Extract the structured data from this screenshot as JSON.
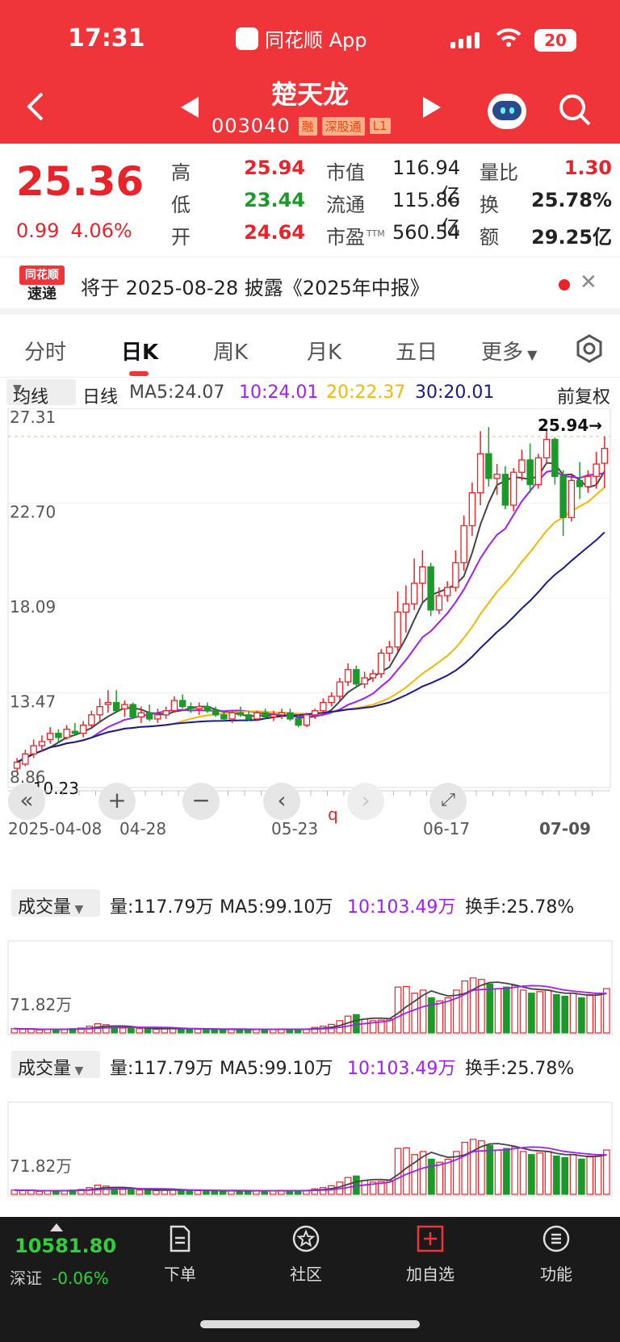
{
  "status": {
    "time": "17:31",
    "app": "同花顺 App",
    "battery": "20"
  },
  "header": {
    "title": "楚天龙",
    "code": "003040",
    "tags": [
      "融",
      "深股通",
      "L1"
    ]
  },
  "quote": {
    "price": "25.36",
    "change": "0.99",
    "pct": "4.06%",
    "high_label": "高",
    "high": "25.94",
    "low_label": "低",
    "low": "23.44",
    "open_label": "开",
    "open": "24.64",
    "mcap_label": "市值",
    "mcap": "116.94亿",
    "float_label": "流通",
    "float": "115.86亿",
    "pe_label": "市盈",
    "pe_sup": "TTM",
    "pe": "560.54",
    "vr_label": "量比",
    "vr": "1.30",
    "turn_label": "换",
    "turn": "25.78%",
    "amt_label": "额",
    "amt": "29.25亿"
  },
  "news": {
    "badge_top": "同花顺",
    "badge_bottom": "速递",
    "text": "将于 2025-08-28 披露《2025年中报》"
  },
  "tabs": [
    "分时",
    "日K",
    "周K",
    "月K",
    "五日",
    "更多"
  ],
  "ma": {
    "dropdown": "均线",
    "kind": "日线",
    "ma5": "MA5:24.07",
    "ma10": "10:24.01",
    "ma20": "20:22.37",
    "ma30": "30:20.01",
    "adjust": "前复权"
  },
  "kline": {
    "y_labels": [
      "27.31",
      "22.70",
      "18.09",
      "13.47",
      "8.86"
    ],
    "high_mark": "25.94→",
    "low_mark": "←10.23",
    "x_labels": [
      "2025-04-08",
      "04-28",
      "05-23",
      "06-17",
      "07-09"
    ],
    "q_mark": "q"
  },
  "volume": {
    "dropdown": "成交量",
    "vol": "量:117.79万",
    "ma5": "MA5:99.10万",
    "ma10": "10:103.49万",
    "turn": "换手:25.78%",
    "y_label": "71.82万"
  },
  "footer": {
    "index": "10581.80",
    "index_name": "深证",
    "index_chg": "-0.06%",
    "nav": [
      "下单",
      "社区",
      "加自选",
      "功能"
    ]
  },
  "colors": {
    "header": "#f0353a",
    "up": "#e8232a",
    "down": "#1b9a2a",
    "ma5": "#444444",
    "ma10": "#a020f0",
    "ma20": "#f5b800",
    "ma30": "#1a1a90"
  },
  "chart_data": {
    "type": "candlestick",
    "ylim": [
      8.86,
      27.31
    ],
    "candles": [
      [
        9.8,
        10.3,
        9.6,
        10.1
      ],
      [
        10.0,
        10.7,
        9.9,
        10.5
      ],
      [
        10.5,
        11.2,
        10.3,
        10.9
      ],
      [
        10.9,
        11.4,
        10.6,
        11.1
      ],
      [
        11.2,
        11.8,
        11.0,
        11.5
      ],
      [
        11.5,
        11.7,
        11.1,
        11.3
      ],
      [
        11.3,
        11.9,
        11.2,
        11.7
      ],
      [
        11.6,
        12.0,
        11.4,
        11.5
      ],
      [
        11.5,
        12.1,
        11.3,
        11.9
      ],
      [
        11.9,
        12.6,
        11.8,
        12.4
      ],
      [
        12.4,
        13.2,
        12.0,
        12.8
      ],
      [
        12.9,
        13.6,
        12.5,
        13.0
      ],
      [
        13.0,
        13.6,
        12.7,
        12.6
      ],
      [
        12.7,
        13.1,
        12.3,
        12.9
      ],
      [
        12.9,
        13.0,
        12.2,
        12.3
      ],
      [
        12.3,
        12.8,
        12.0,
        12.5
      ],
      [
        12.5,
        12.9,
        12.1,
        12.2
      ],
      [
        12.2,
        12.7,
        12.0,
        12.4
      ],
      [
        12.4,
        12.8,
        12.2,
        12.6
      ],
      [
        12.6,
        13.3,
        12.5,
        13.1
      ],
      [
        13.1,
        13.4,
        12.7,
        12.8
      ],
      [
        12.8,
        13.0,
        12.5,
        12.7
      ],
      [
        12.7,
        13.0,
        12.4,
        12.8
      ],
      [
        12.8,
        13.0,
        12.5,
        12.6
      ],
      [
        12.6,
        12.8,
        12.3,
        12.4
      ],
      [
        12.4,
        12.6,
        12.1,
        12.2
      ],
      [
        12.2,
        12.6,
        12.0,
        12.5
      ],
      [
        12.5,
        12.8,
        12.3,
        12.4
      ],
      [
        12.4,
        12.6,
        12.1,
        12.2
      ],
      [
        12.2,
        12.6,
        12.1,
        12.5
      ],
      [
        12.5,
        12.7,
        12.2,
        12.3
      ],
      [
        12.3,
        12.6,
        12.1,
        12.4
      ],
      [
        12.4,
        12.7,
        12.2,
        12.5
      ],
      [
        12.5,
        12.7,
        12.1,
        12.2
      ],
      [
        12.2,
        12.4,
        11.8,
        11.9
      ],
      [
        11.9,
        12.5,
        11.8,
        12.4
      ],
      [
        12.4,
        12.7,
        12.2,
        12.6
      ],
      [
        12.6,
        13.2,
        12.5,
        13.0
      ],
      [
        13.0,
        13.5,
        12.8,
        13.3
      ],
      [
        13.3,
        14.2,
        13.1,
        14.0
      ],
      [
        14.0,
        14.9,
        13.8,
        14.6
      ],
      [
        14.6,
        14.8,
        13.7,
        13.9
      ],
      [
        13.9,
        14.5,
        13.7,
        14.2
      ],
      [
        14.2,
        14.6,
        14.0,
        14.4
      ],
      [
        14.4,
        15.6,
        14.2,
        15.4
      ],
      [
        15.4,
        16.0,
        15.0,
        15.7
      ],
      [
        15.7,
        18.4,
        15.5,
        17.4
      ],
      [
        17.4,
        18.7,
        16.4,
        17.8
      ],
      [
        17.8,
        20.0,
        17.5,
        18.8
      ],
      [
        18.8,
        20.4,
        17.9,
        19.6
      ],
      [
        19.6,
        19.8,
        17.2,
        17.5
      ],
      [
        17.5,
        18.6,
        17.3,
        18.2
      ],
      [
        18.2,
        18.9,
        17.9,
        18.6
      ],
      [
        18.6,
        20.4,
        18.4,
        19.8
      ],
      [
        19.8,
        22.1,
        19.4,
        21.6
      ],
      [
        21.6,
        23.7,
        21.1,
        23.2
      ],
      [
        23.2,
        26.2,
        22.6,
        25.1
      ],
      [
        25.1,
        26.4,
        23.5,
        23.9
      ],
      [
        23.9,
        24.6,
        23.1,
        24.1
      ],
      [
        24.1,
        24.5,
        22.4,
        22.6
      ],
      [
        22.6,
        24.4,
        22.3,
        24.2
      ],
      [
        24.2,
        25.3,
        23.8,
        24.8
      ],
      [
        24.8,
        25.6,
        23.2,
        23.6
      ],
      [
        23.6,
        25.1,
        23.4,
        24.9
      ],
      [
        24.9,
        26.3,
        24.6,
        25.8
      ],
      [
        25.8,
        25.9,
        23.6,
        24.0
      ],
      [
        24.0,
        24.3,
        21.1,
        22.0
      ],
      [
        22.0,
        24.1,
        21.8,
        23.8
      ],
      [
        23.8,
        24.7,
        22.9,
        23.5
      ],
      [
        23.5,
        24.3,
        23.2,
        24.0
      ],
      [
        24.0,
        25.2,
        23.4,
        24.6
      ],
      [
        24.64,
        25.94,
        23.44,
        25.36
      ]
    ],
    "ma5_end": 24.07,
    "ma10_end": 24.01,
    "ma20_end": 22.37,
    "ma30_end": 20.01,
    "volumes": [
      14,
      12,
      13,
      10,
      12,
      11,
      13,
      14,
      16,
      22,
      30,
      27,
      18,
      16,
      15,
      14,
      13,
      12,
      14,
      16,
      14,
      13,
      12,
      12,
      11,
      11,
      12,
      12,
      11,
      12,
      11,
      12,
      13,
      12,
      12,
      13,
      18,
      22,
      28,
      40,
      55,
      60,
      45,
      40,
      42,
      45,
      150,
      152,
      130,
      140,
      115,
      105,
      115,
      140,
      170,
      180,
      175,
      160,
      145,
      150,
      155,
      140,
      130,
      135,
      140,
      125,
      120,
      130,
      115,
      125,
      130,
      145
    ]
  }
}
